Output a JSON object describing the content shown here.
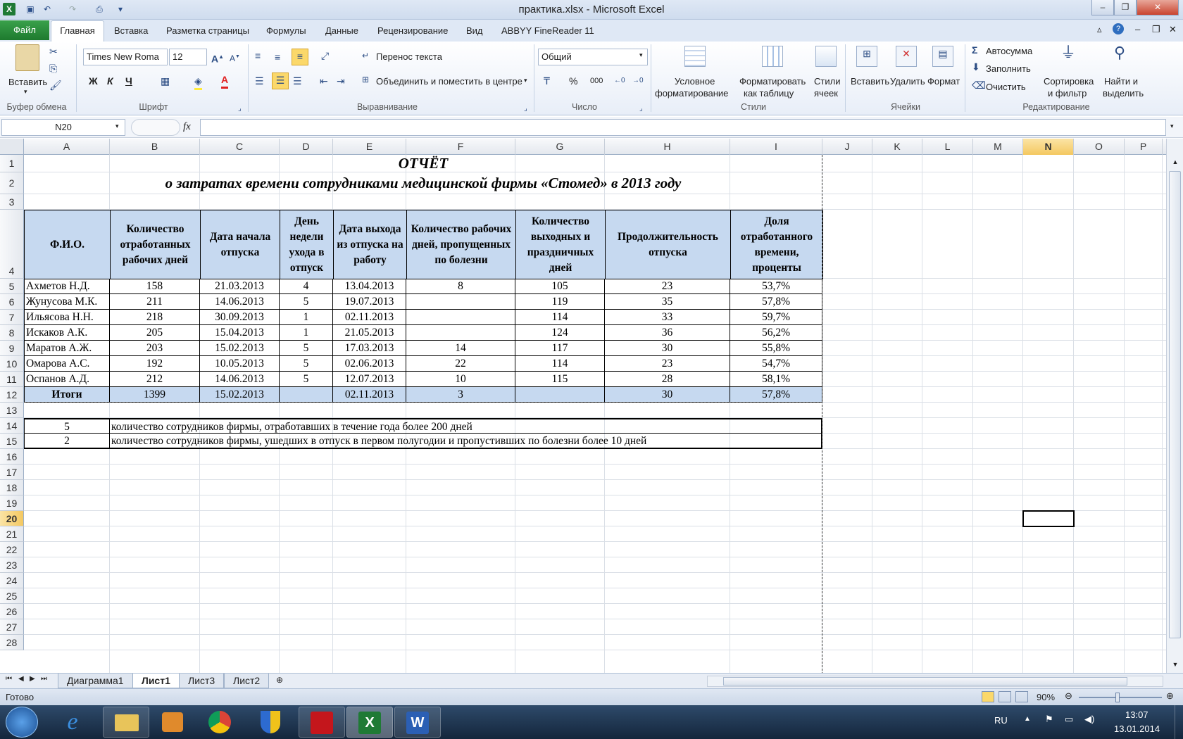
{
  "window": {
    "title": "практика.xlsx - Microsoft Excel",
    "controls": [
      "–",
      "❐",
      "✕"
    ]
  },
  "menu": {
    "file": "Файл",
    "tabs": [
      "Главная",
      "Вставка",
      "Разметка страницы",
      "Формулы",
      "Данные",
      "Рецензирование",
      "Вид",
      "ABBYY FineReader 11"
    ]
  },
  "ribbon": {
    "clipboard": {
      "paste": "Вставить",
      "label": "Буфер обмена"
    },
    "font": {
      "name": "Times New Roma",
      "size": "12",
      "bold": "Ж",
      "italic": "К",
      "underline": "Ч",
      "label": "Шрифт"
    },
    "alignment": {
      "wrap": "Перенос текста",
      "merge": "Объединить и поместить в центре",
      "label": "Выравнивание"
    },
    "number": {
      "format": "Общий",
      "percent": "%",
      "thousands": "000",
      "label": "Число"
    },
    "styles": {
      "conditional": [
        "Условное",
        "форматирование"
      ],
      "as_table": [
        "Форматировать",
        "как таблицу"
      ],
      "cell_styles": [
        "Стили",
        "ячеек"
      ],
      "label": "Стили"
    },
    "cells": {
      "insert": "Вставить",
      "delete": "Удалить",
      "format": "Формат",
      "label": "Ячейки"
    },
    "editing": {
      "autosum": "Автосумма",
      "fill": "Заполнить",
      "clear": "Очистить",
      "sort": [
        "Сортировка",
        "и фильтр"
      ],
      "find": [
        "Найти и",
        "выделить"
      ],
      "label": "Редактирование"
    }
  },
  "formula_bar": {
    "name_box": "N20",
    "fx": "fx",
    "formula": ""
  },
  "columns": [
    "A",
    "B",
    "C",
    "D",
    "E",
    "F",
    "G",
    "H",
    "I",
    "J",
    "K",
    "L",
    "M",
    "N",
    "O",
    "P"
  ],
  "rows": [
    "1",
    "2",
    "3",
    "4",
    "5",
    "6",
    "7",
    "8",
    "9",
    "10",
    "11",
    "12",
    "13",
    "14",
    "15",
    "16",
    "17",
    "18",
    "19",
    "20",
    "21",
    "22",
    "23",
    "24",
    "25",
    "26",
    "27",
    "28"
  ],
  "sheet": {
    "title": "ОТЧЁТ",
    "subtitle": "о затратах времени сотрудниками медицинской фирмы «Стомед» в 2013 году",
    "headers": [
      "Ф.И.О.",
      "Количество отработанных рабочих дней",
      "Дата начала отпуска",
      "День недели ухода в отпуск",
      "Дата выхода из отпуска на работу",
      "Количество рабочих дней, пропущенных по болезни",
      "Количество выходных и праздничных дней",
      "Продолжительность отпуска",
      "Доля отработанного времени, проценты"
    ],
    "data": [
      [
        "Ахметов Н.Д.",
        "158",
        "21.03.2013",
        "4",
        "13.04.2013",
        "8",
        "105",
        "23",
        "53,7%"
      ],
      [
        "Жунусова М.К.",
        "211",
        "14.06.2013",
        "5",
        "19.07.2013",
        "",
        "119",
        "35",
        "57,8%"
      ],
      [
        "Ильясова Н.Н.",
        "218",
        "30.09.2013",
        "1",
        "02.11.2013",
        "",
        "114",
        "33",
        "59,7%"
      ],
      [
        "Искаков А.К.",
        "205",
        "15.04.2013",
        "1",
        "21.05.2013",
        "",
        "124",
        "36",
        "56,2%"
      ],
      [
        "Маратов А.Ж.",
        "203",
        "15.02.2013",
        "5",
        "17.03.2013",
        "14",
        "117",
        "30",
        "55,8%"
      ],
      [
        "Омарова А.С.",
        "192",
        "10.05.2013",
        "5",
        "02.06.2013",
        "22",
        "114",
        "23",
        "54,7%"
      ],
      [
        "Оспанов А.Д.",
        "212",
        "14.06.2013",
        "5",
        "12.07.2013",
        "10",
        "115",
        "28",
        "58,1%"
      ]
    ],
    "totals": [
      "Итоги",
      "1399",
      "15.02.2013",
      "",
      "02.11.2013",
      "3",
      "",
      "30",
      "57,8%"
    ],
    "notes": [
      {
        "value": "5",
        "text": "количество сотрудников фирмы, отработавших в течение года более 200 дней"
      },
      {
        "value": "2",
        "text": "количество сотрудников фирмы, ушедших в отпуск в первом полугодии и пропустивших по болезни более 10 дней"
      }
    ]
  },
  "sheet_tabs": [
    "Диаграмма1",
    "Лист1",
    "Лист3",
    "Лист2"
  ],
  "active_sheet": "Лист1",
  "status": {
    "ready": "Готово",
    "zoom": "90%"
  },
  "taskbar": {
    "lang": "RU",
    "time": "13:07",
    "date": "13.01.2014"
  }
}
